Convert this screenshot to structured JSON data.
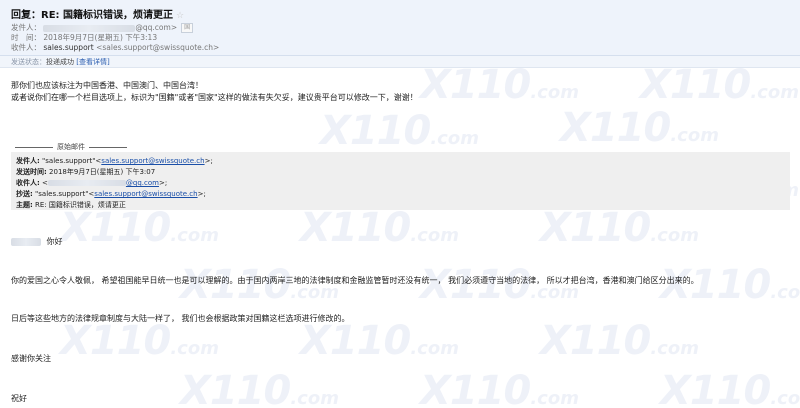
{
  "header": {
    "subject": "回复：RE: 国籍标识错误，烦请更正",
    "star_icon": "star-icon",
    "from_label": "发件人：",
    "from_domain": "@qq.com>",
    "from_tag": "国",
    "time_label": "时　间：",
    "time_value": "2018年9月7日(星期五) 下午3:13",
    "to_label": "收件人：",
    "to_name": "sales.support",
    "to_email": "<sales.support@swissquote.ch>"
  },
  "status": {
    "label": "发送状态：",
    "value": "投递成功",
    "link": "[查看详情]"
  },
  "reply": {
    "line1": "那你们也应该标注为中国香港、中国澳门、中国台湾！",
    "line2": "或者说你们在哪一个栏目选项上，标识为\"国籍\"或者\"国家\"这样的做法有失欠妥，建议贵平台可以修改一下，谢谢！"
  },
  "original": {
    "title": "原始邮件",
    "from_label": "发件人:",
    "from_name": "\"sales.support\"",
    "from_email": "sales.support@swissquote.ch",
    "sent_label": "发送时间:",
    "sent_value": "2018年9月7日(星期五) 下午3:07",
    "to_label": "收件人:",
    "to_domain": "@qq.com",
    "cc_label": "抄送:",
    "cc_name": "\"sales.support\"",
    "cc_email": "sales.support@swissquote.ch",
    "subject_label": "主题:",
    "subject_value": "RE: 国籍标识错误，烦请更正"
  },
  "body": {
    "greeting": "你好",
    "para1": "你的爱国之心令人敬佩， 希望祖国能早日统一也是可以理解的。由于国内两岸三地的法律制度和金融监管暂时还没有统一， 我们必须遵守当地的法律， 所以才把台湾，香港和澳门给区分出来的。",
    "para2": "日后等这些地方的法律规章制度与大陆一样了， 我们也会根据政策对国籍这栏选项进行修改的。",
    "thanks": "感谢你关注",
    "closing": "祝好"
  },
  "watermark": {
    "big": "X110",
    "small": ".com"
  }
}
